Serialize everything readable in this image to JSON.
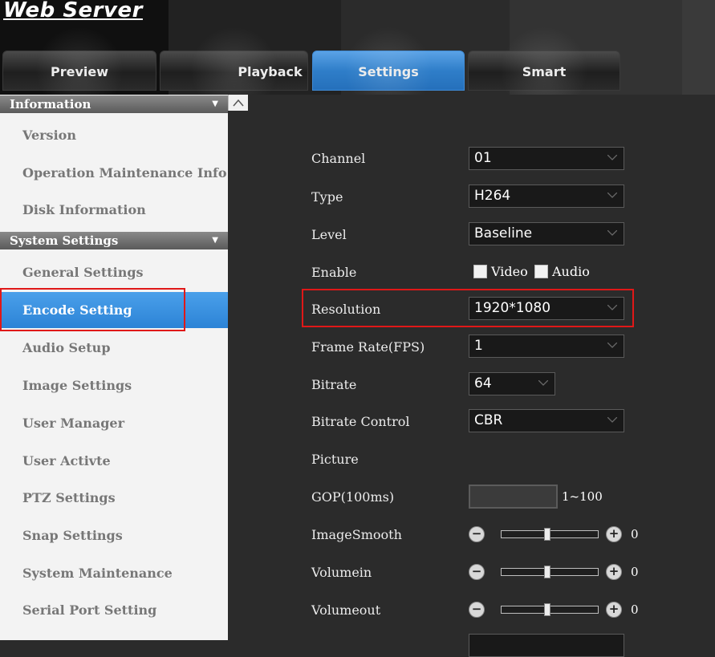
{
  "header": {
    "title": "Web Server",
    "tabs": [
      {
        "label": "Preview"
      },
      {
        "label": "Playback"
      },
      {
        "label": "Settings"
      },
      {
        "label": "Smart"
      }
    ]
  },
  "sidebar": {
    "sections": [
      {
        "label": "Information"
      },
      {
        "label": "System Settings"
      }
    ],
    "info_items": [
      {
        "label": "Version"
      },
      {
        "label": "Operation Maintenance Info"
      },
      {
        "label": "Disk Information"
      }
    ],
    "system_items": [
      {
        "label": "General Settings"
      },
      {
        "label": "Encode Setting"
      },
      {
        "label": "Audio Setup"
      },
      {
        "label": "Image Settings"
      },
      {
        "label": "User Manager"
      },
      {
        "label": "User Activte"
      },
      {
        "label": "PTZ Settings"
      },
      {
        "label": "Snap Settings"
      },
      {
        "label": "System Maintenance"
      },
      {
        "label": "Serial Port Setting"
      }
    ]
  },
  "form": {
    "channel": {
      "label": "Channel",
      "value": "01"
    },
    "type": {
      "label": "Type",
      "value": "H264"
    },
    "level": {
      "label": "Level",
      "value": "Baseline"
    },
    "enable": {
      "label": "Enable",
      "video": "Video",
      "audio": "Audio"
    },
    "resolution": {
      "label": "Resolution",
      "value": "1920*1080"
    },
    "frame_rate": {
      "label": "Frame Rate(FPS)",
      "value": "1"
    },
    "bitrate": {
      "label": "Bitrate",
      "value": "64"
    },
    "bitrate_control": {
      "label": "Bitrate Control",
      "value": "CBR"
    },
    "picture": {
      "label": "Picture"
    },
    "gop": {
      "label": "GOP(100ms)",
      "range": "1~100"
    },
    "image_smooth": {
      "label": "ImageSmooth",
      "value": "0"
    },
    "volume_in": {
      "label": "Volumein",
      "value": "0"
    },
    "volume_out": {
      "label": "Volumeout",
      "value": "0"
    },
    "minus": "−",
    "plus": "+"
  },
  "colors": {
    "accent": "#2f7ec9",
    "highlight_border": "#e01818"
  }
}
